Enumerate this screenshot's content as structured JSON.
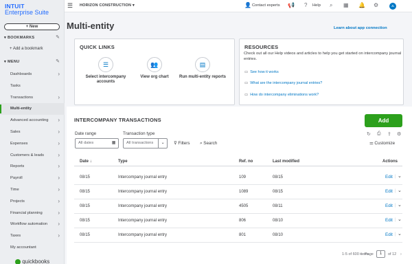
{
  "brand": {
    "line1": "INTUIT",
    "line2": "Enterprise Suite"
  },
  "new_button": "+ New",
  "bookmarks": {
    "header": "BOOKMARKS",
    "add": "+ Add a bookmark"
  },
  "menu": {
    "header": "MENU",
    "items": [
      {
        "label": "Dashboards",
        "chevron": true
      },
      {
        "label": "Tasks",
        "chevron": false
      },
      {
        "label": "Transactions",
        "chevron": true
      },
      {
        "label": "Multi-entity",
        "chevron": false,
        "active": true
      },
      {
        "label": "Advanced accounting",
        "chevron": true
      },
      {
        "label": "Sales",
        "chevron": true
      },
      {
        "label": "Expenses",
        "chevron": true
      },
      {
        "label": "Customers & leads",
        "chevron": true
      },
      {
        "label": "Reports",
        "chevron": true
      },
      {
        "label": "Payroll",
        "chevron": true
      },
      {
        "label": "Time",
        "chevron": true
      },
      {
        "label": "Projects",
        "chevron": true
      },
      {
        "label": "Financial planning",
        "chevron": true
      },
      {
        "label": "Workflow automation",
        "chevron": true
      },
      {
        "label": "Taxes",
        "chevron": true
      },
      {
        "label": "My accountant",
        "chevron": false
      }
    ]
  },
  "footer_logo": "quickbooks",
  "topbar": {
    "company": "HORIZON CONSTRUCTION",
    "contact": "Contact experts",
    "help": "Help",
    "avatar": "JL"
  },
  "page": {
    "title": "Multi-entity",
    "learn_link": "Learn about app connection"
  },
  "quick_links": {
    "title": "QUICK LINKS",
    "items": [
      {
        "label": "Select intercompany accounts",
        "icon": "list-icon"
      },
      {
        "label": "View org chart",
        "icon": "people-icon"
      },
      {
        "label": "Run multi-entity reports",
        "icon": "report-icon"
      }
    ]
  },
  "resources": {
    "title": "RESOURCES",
    "text": "Check out all our Help videos and articles to help you get started on intercompany journal entries.",
    "links": [
      "See how it works",
      "What are the intercompany journal entries?",
      "How do intercompany eliminations work?"
    ]
  },
  "transactions": {
    "title": "INTERCOMPANY TRANSACTIONS",
    "add_label": "Add",
    "date_range_label": "Date range",
    "date_range_value": "All dates",
    "type_label": "Transaction type",
    "type_value": "All transactions",
    "filters": "Filters",
    "search": "Search",
    "customize": "Customize",
    "columns": [
      "Date",
      "Type",
      "Ref. no",
      "Last modified",
      "Actions"
    ],
    "rows": [
      {
        "date": "08/15",
        "type": "Intercompany journal entry",
        "ref": "109",
        "modified": "08/15",
        "action": "Edit"
      },
      {
        "date": "08/15",
        "type": "Intercompany journal entry",
        "ref": "1089",
        "modified": "08/15",
        "action": "Edit"
      },
      {
        "date": "08/15",
        "type": "Intercompany journal entry",
        "ref": "4505",
        "modified": "08/11",
        "action": "Edit"
      },
      {
        "date": "08/15",
        "type": "Intercompany journal entry",
        "ref": "806",
        "modified": "08/10",
        "action": "Edit"
      },
      {
        "date": "08/15",
        "type": "Intercompany journal entry",
        "ref": "801",
        "modified": "08/10",
        "action": "Edit"
      }
    ],
    "pagination": {
      "summary": "1-5 of 600 items",
      "page_label": "Page",
      "page": "1",
      "of": "of 12"
    }
  }
}
